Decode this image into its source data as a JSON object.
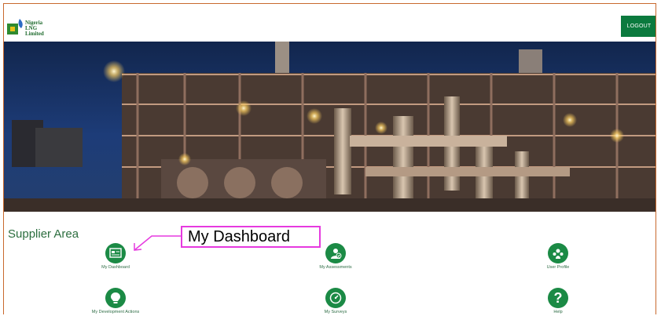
{
  "header": {
    "logo_lines": [
      "Nigeria",
      "LNG",
      "Limited"
    ],
    "logout_label": "LOGOUT"
  },
  "banner": {
    "alt": ""
  },
  "supplier_area": {
    "title": "Supplier Area",
    "tiles": [
      {
        "label": "My Dashboard",
        "icon": "dashboard-icon"
      },
      {
        "label": "My Assessments",
        "icon": "assessments-icon"
      },
      {
        "label": "User Profile",
        "icon": "user-profile-icon"
      },
      {
        "label": "My Development Actions",
        "icon": "lightbulb-icon"
      },
      {
        "label": "My Surveys",
        "icon": "gauge-icon"
      },
      {
        "label": "Help",
        "icon": "question-icon"
      }
    ]
  },
  "annotation": {
    "callout_text": "My Dashboard",
    "color": "#e63adf"
  },
  "colors": {
    "accent": "#0b7a3e",
    "icon_bg": "#1b8a45",
    "frame": "#c8692e"
  }
}
